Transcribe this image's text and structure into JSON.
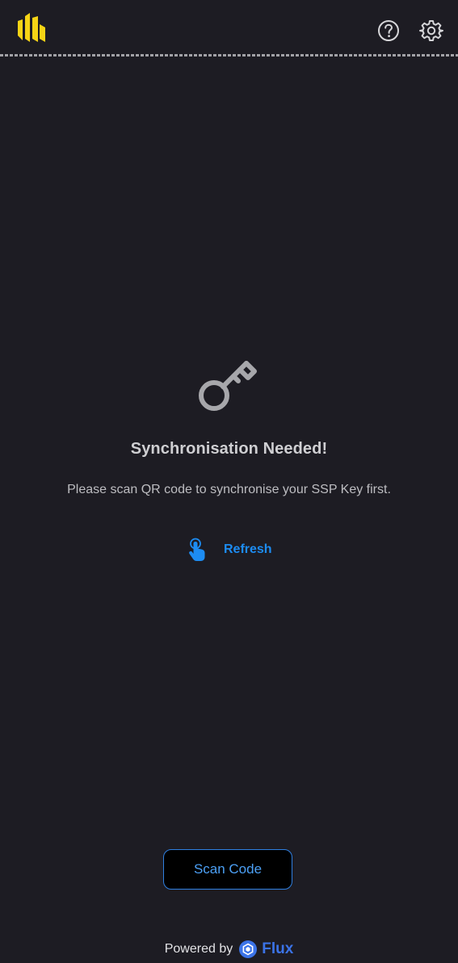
{
  "header": {
    "logo_icon": "ssp-logo-icon",
    "help_icon": "help-icon",
    "settings_icon": "gear-icon"
  },
  "main": {
    "icon": "key-icon",
    "title": "Synchronisation Needed!",
    "message": "Please scan QR code to synchronise your SSP Key first.",
    "refresh_icon": "pointer-hand-icon",
    "refresh_label": "Refresh"
  },
  "actions": {
    "scan_label": "Scan Code"
  },
  "footer": {
    "powered_by": "Powered by",
    "brand": "Flux",
    "brand_icon": "flux-logo-icon"
  },
  "colors": {
    "background": "#1d1c23",
    "accent": "#1d8cf2",
    "logo_yellow": "#f6d415",
    "text": "#cfcfd2"
  }
}
